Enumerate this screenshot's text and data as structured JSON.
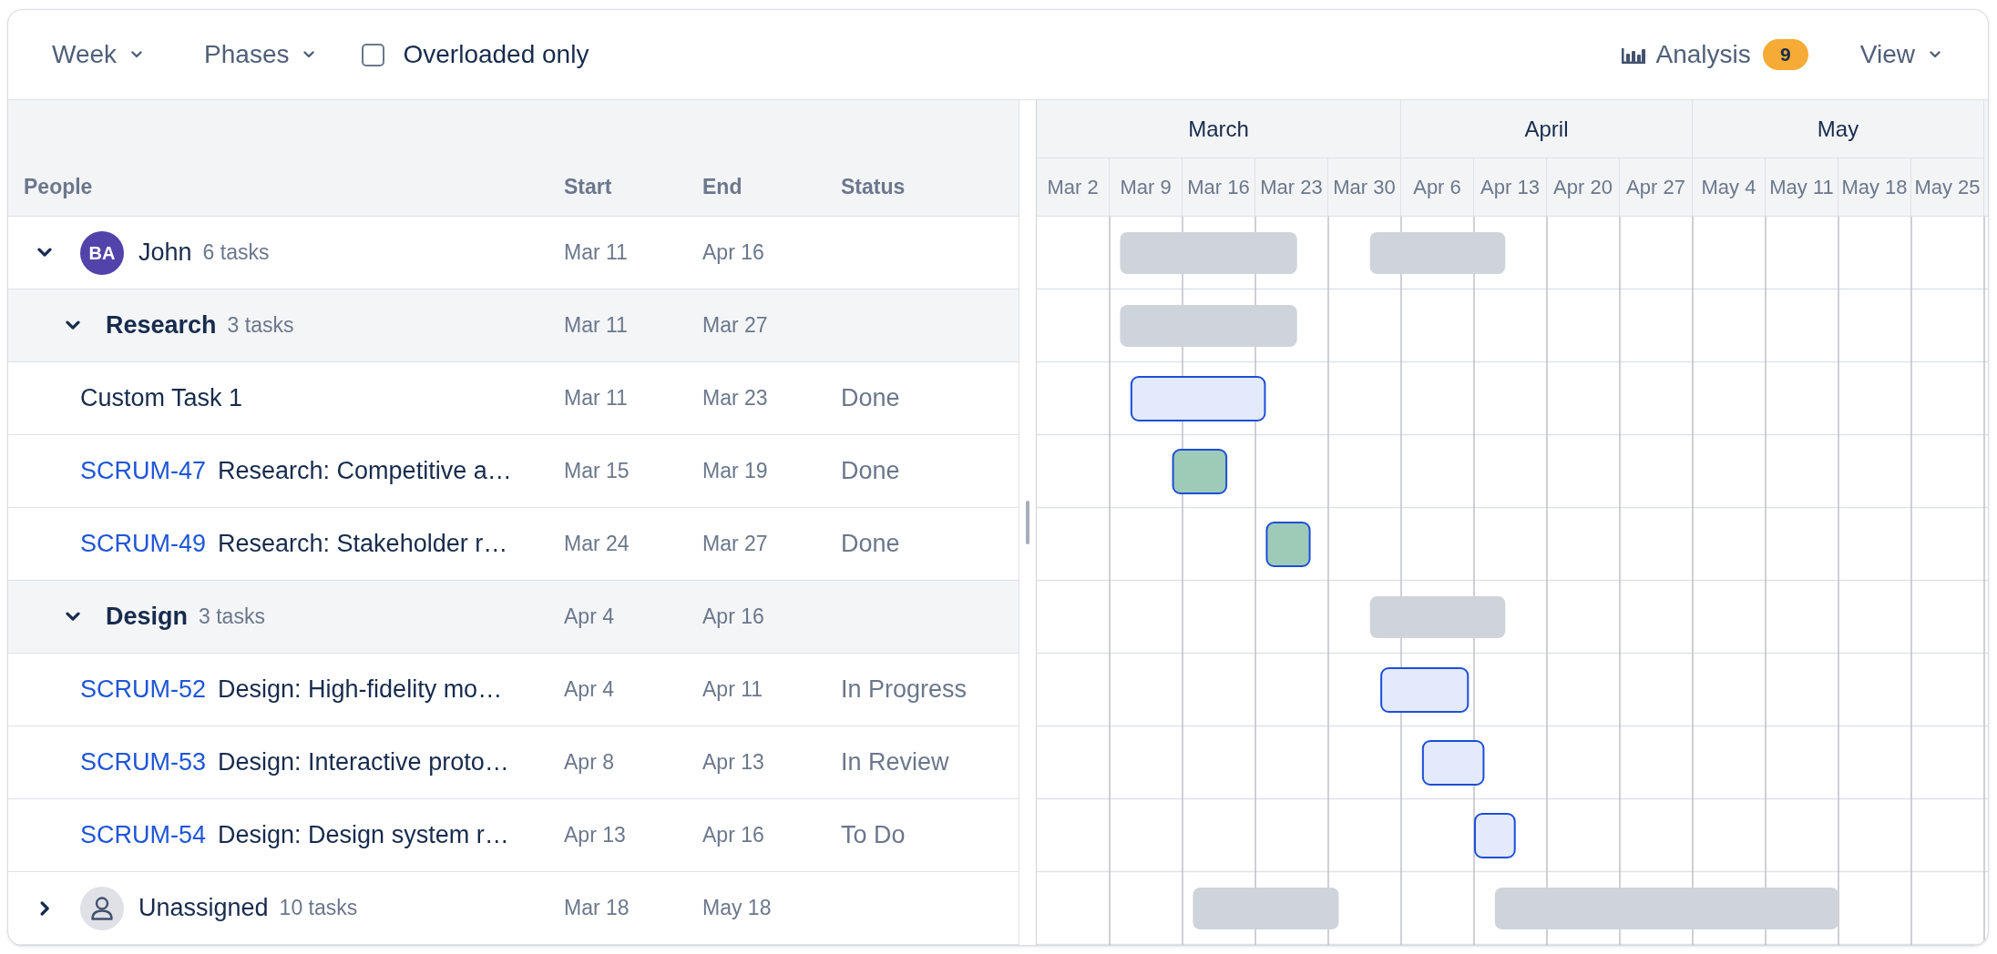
{
  "toolbar": {
    "left": [
      {
        "kind": "dropdown",
        "label": "Week"
      },
      {
        "kind": "dropdown",
        "label": "Phases"
      },
      {
        "kind": "checkbox",
        "label": "Overloaded only",
        "checked": false
      }
    ],
    "right": [
      {
        "kind": "analysis",
        "label": "Analysis",
        "badge": "9"
      },
      {
        "kind": "dropdown",
        "label": "View"
      }
    ]
  },
  "table": {
    "columns": [
      "People",
      "Start",
      "End",
      "Status"
    ],
    "rows": [
      {
        "kind": "person",
        "name": "John",
        "avatar": {
          "kind": "initials",
          "initials": "BA",
          "color": "#5243aa"
        },
        "count": "6 tasks",
        "start": "Mar 11",
        "end": "Apr 16",
        "expanded": true,
        "children": [
          {
            "kind": "phase",
            "name": "Research",
            "count": "3 tasks",
            "start": "Mar 11",
            "end": "Mar 27",
            "expanded": true,
            "children": [
              {
                "kind": "task",
                "title": "Custom Task 1",
                "start": "Mar 11",
                "end": "Mar 23",
                "status": "Done"
              },
              {
                "kind": "task",
                "key": "SCRUM-47",
                "title": "Research: Competitive a…",
                "start": "Mar 15",
                "end": "Mar 19",
                "status": "Done"
              },
              {
                "kind": "task",
                "key": "SCRUM-49",
                "title": "Research: Stakeholder r…",
                "start": "Mar 24",
                "end": "Mar 27",
                "status": "Done"
              }
            ]
          },
          {
            "kind": "phase",
            "name": "Design",
            "count": "3 tasks",
            "start": "Apr 4",
            "end": "Apr 16",
            "expanded": true,
            "children": [
              {
                "kind": "task",
                "key": "SCRUM-52",
                "title": "Design: High-fidelity mo…",
                "start": "Apr 4",
                "end": "Apr 11",
                "status": "In Progress"
              },
              {
                "kind": "task",
                "key": "SCRUM-53",
                "title": "Design: Interactive proto…",
                "start": "Apr 8",
                "end": "Apr 13",
                "status": "In Review"
              },
              {
                "kind": "task",
                "key": "SCRUM-54",
                "title": "Design: Design system r…",
                "start": "Apr 13",
                "end": "Apr 16",
                "status": "To Do"
              }
            ]
          }
        ]
      },
      {
        "kind": "person",
        "name": "Unassigned",
        "avatar": {
          "kind": "placeholder"
        },
        "count": "10 tasks",
        "start": "Mar 18",
        "end": "May 18",
        "expanded": false
      }
    ]
  },
  "timeline": {
    "months": [
      {
        "label": "March",
        "weeks": [
          "Mar 2",
          "Mar 9",
          "Mar 16",
          "Mar 23",
          "Mar 30"
        ]
      },
      {
        "label": "April",
        "weeks": [
          "Apr 6",
          "Apr 13",
          "Apr 20",
          "Apr 27"
        ]
      },
      {
        "label": "May",
        "weeks": [
          "May 4",
          "May 11",
          "May 18",
          "May 25"
        ]
      }
    ]
  }
}
